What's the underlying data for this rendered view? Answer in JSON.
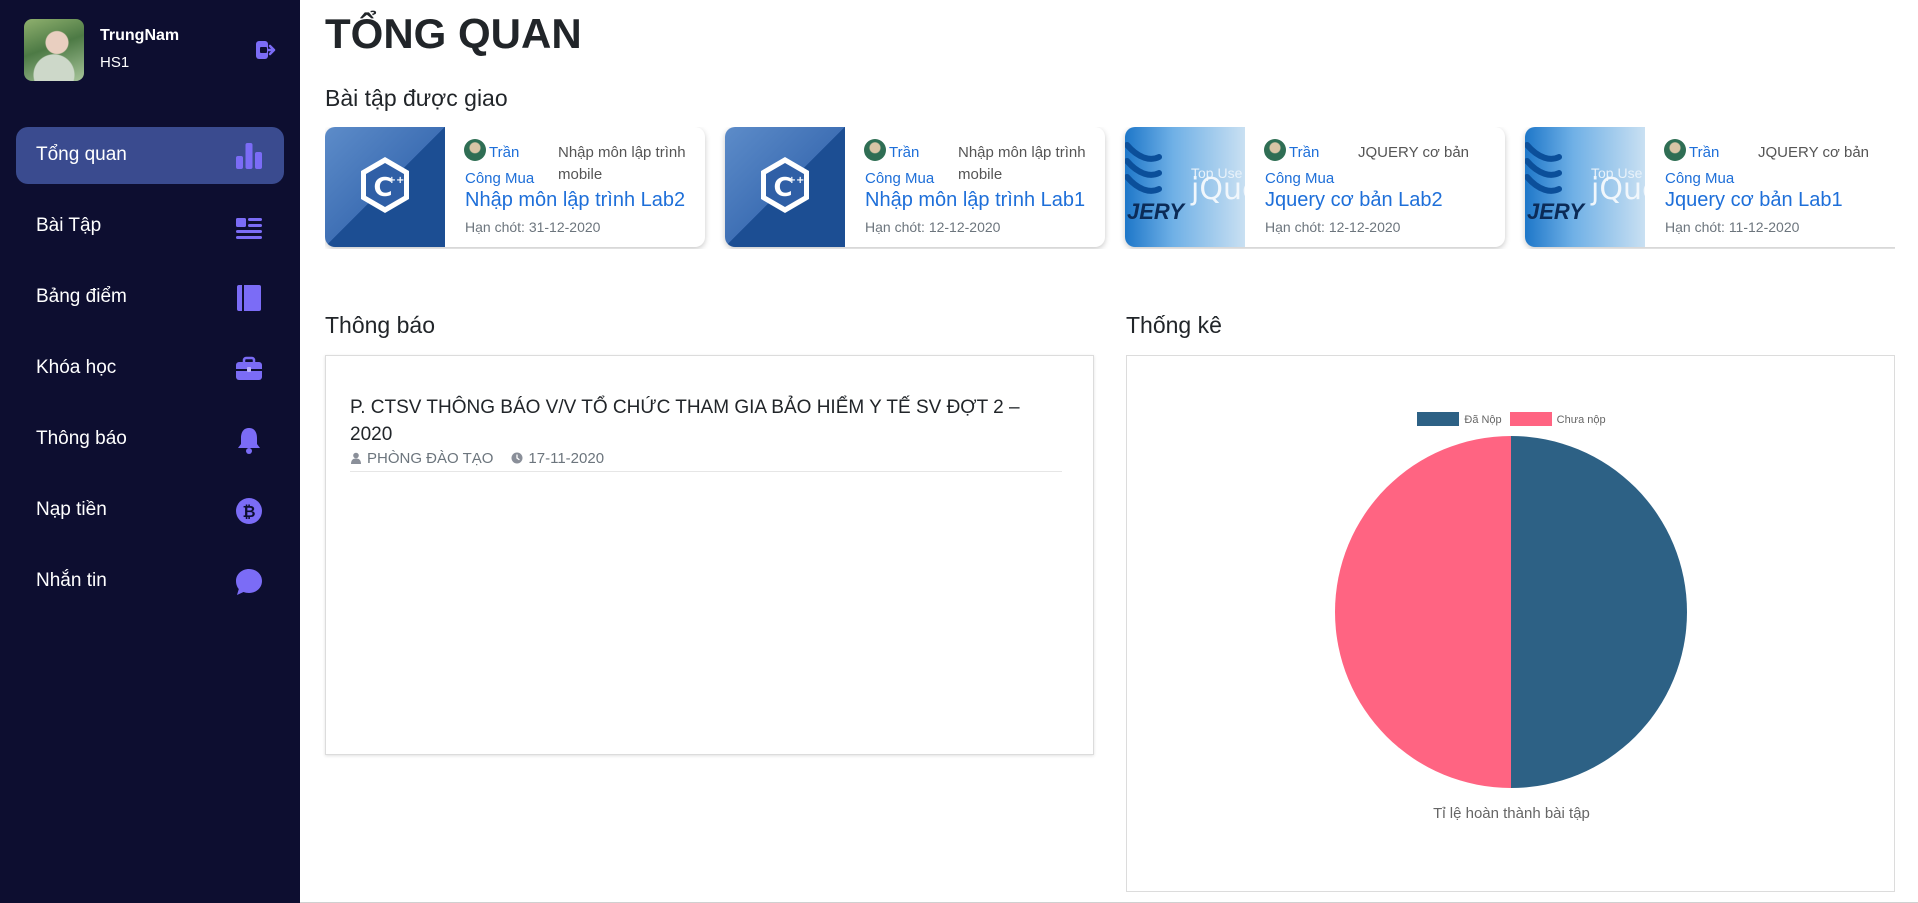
{
  "user": {
    "name": "TrungNam",
    "role": "HS1"
  },
  "sidebar": {
    "items": [
      {
        "label": "Tổng quan",
        "icon": "bar-chart-icon"
      },
      {
        "label": "Bài Tập",
        "icon": "list-icon"
      },
      {
        "label": "Bảng điểm",
        "icon": "notebook-icon"
      },
      {
        "label": "Khóa học",
        "icon": "briefcase-icon"
      },
      {
        "label": "Thông báo",
        "icon": "bell-icon"
      },
      {
        "label": "Nạp tiền",
        "icon": "bitcoin-icon"
      },
      {
        "label": "Nhắn tin",
        "icon": "chat-icon"
      }
    ]
  },
  "header": {
    "title": "TỔNG QUAN"
  },
  "assignments": {
    "title": "Bài tập được giao",
    "cards": [
      {
        "author": "Trần Công Mua",
        "course": "Nhập môn lập trình mobile",
        "title": "Nhập môn lập trình Lab2",
        "deadline": "Hạn chót: 31-12-2020",
        "thumb": "cpp"
      },
      {
        "author": "Trần Công Mua",
        "course": "Nhập môn lập trình mobile",
        "title": "Nhập môn lập trình Lab1",
        "deadline": "Hạn chót: 12-12-2020",
        "thumb": "cpp"
      },
      {
        "author": "Trần Công Mua",
        "course": "JQUERY cơ bản",
        "title": "Jquery cơ bản Lab2",
        "deadline": "Hạn chót: 12-12-2020",
        "thumb": "jquery"
      },
      {
        "author": "Trần Công Mua",
        "course": "JQUERY cơ bản",
        "title": "Jquery cơ bản Lab1",
        "deadline": "Hạn chót: 11-12-2020",
        "thumb": "jquery"
      }
    ]
  },
  "thumb_text": {
    "top_used": "Top Use",
    "jquery": "jQue",
    "ery": "JERY"
  },
  "notices": {
    "title": "Thông báo",
    "items": [
      {
        "title": "P. CTSV THÔNG BÁO V/V TỔ CHỨC THAM GIA BẢO HIỂM Y TẾ SV ĐỢT 2 – 2020",
        "author": "PHÒNG ĐÀO TẠO",
        "date": "17-11-2020"
      }
    ]
  },
  "stats": {
    "title": "Thống kê",
    "caption": "Tỉ lệ hoàn thành bài tập"
  },
  "colors": {
    "sidebar_bg": "#0d0e30",
    "active_bg": "#3a4b8f",
    "icon_accent": "#7b6cf6",
    "link": "#1e6fd9",
    "submitted": "#2d6185",
    "not_submitted": "#ff6482"
  },
  "chart_data": {
    "type": "pie",
    "labels": [
      "Đã Nộp",
      "Chưa nộp"
    ],
    "values": [
      50,
      50
    ],
    "colors": [
      "#2d6185",
      "#ff6482"
    ],
    "legend": "top",
    "caption": "Tỉ lệ hoàn thành bài tập"
  }
}
